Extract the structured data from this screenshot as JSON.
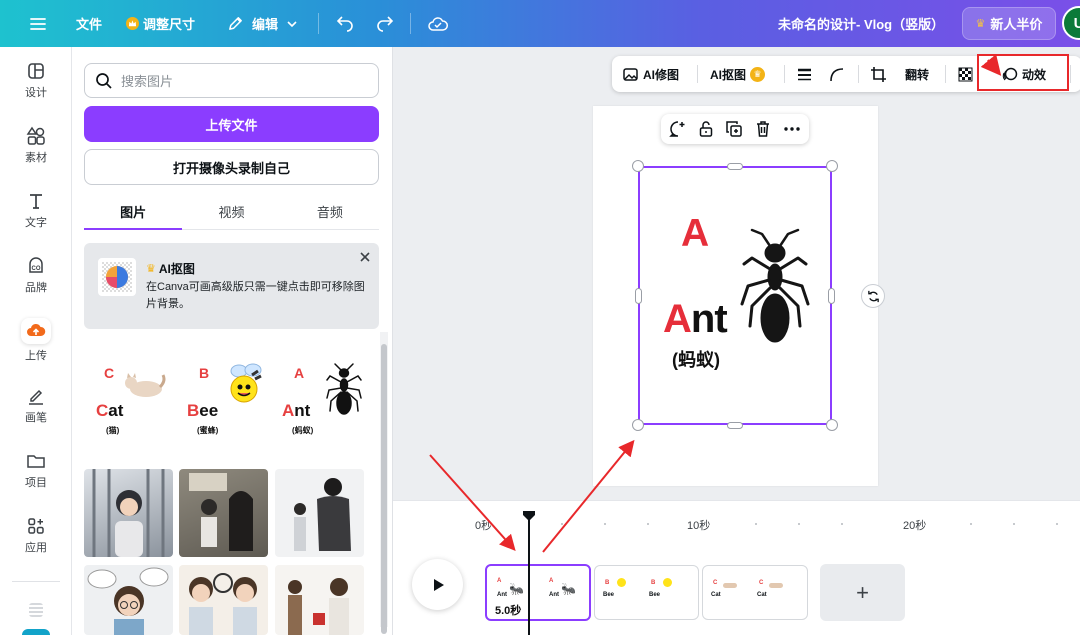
{
  "topbar": {
    "file": "文件",
    "resize": "调整尺寸",
    "edit": "编辑",
    "doc_title": "未命名的设计- Vlog（竖版）",
    "upgrade": "新人半价",
    "avatar_letter": "U"
  },
  "rail": {
    "items": [
      {
        "label": "设计",
        "icon": "layout-icon"
      },
      {
        "label": "素材",
        "icon": "shapes-icon"
      },
      {
        "label": "文字",
        "icon": "text-icon"
      },
      {
        "label": "品牌",
        "icon": "brand-icon"
      },
      {
        "label": "上传",
        "icon": "cloud-upload-icon"
      },
      {
        "label": "画笔",
        "icon": "pen-icon"
      },
      {
        "label": "项目",
        "icon": "folder-icon"
      },
      {
        "label": "应用",
        "icon": "apps-icon"
      }
    ]
  },
  "panel": {
    "search_placeholder": "搜索图片",
    "upload_btn": "上传文件",
    "camera_btn": "打开摄像头录制自己",
    "tabs": [
      "图片",
      "视频",
      "音频"
    ],
    "promo_title": "AI抠图",
    "promo_text": "在Canva可画高级版只需一键点击即可移除图片背景。",
    "flashcards": [
      {
        "letter": "C",
        "first": "C",
        "rest": "at",
        "cn": "(猫)"
      },
      {
        "letter": "B",
        "first": "B",
        "rest": "ee",
        "cn": "(蜜蜂)"
      },
      {
        "letter": "A",
        "first": "A",
        "rest": "nt",
        "cn": "(蚂蚁)"
      }
    ]
  },
  "ctx_toolbar": {
    "ai_edit": "AI修图",
    "ai_cutout": "AI抠图",
    "flip": "翻转",
    "animate": "动效"
  },
  "canvas": {
    "letter": "A",
    "word_first": "A",
    "word_rest": "nt",
    "cn": "(蚂蚁)"
  },
  "timeline": {
    "ticks": [
      "0秒",
      "10秒",
      "20秒"
    ],
    "clip_duration": "5.0秒",
    "add": "+"
  }
}
